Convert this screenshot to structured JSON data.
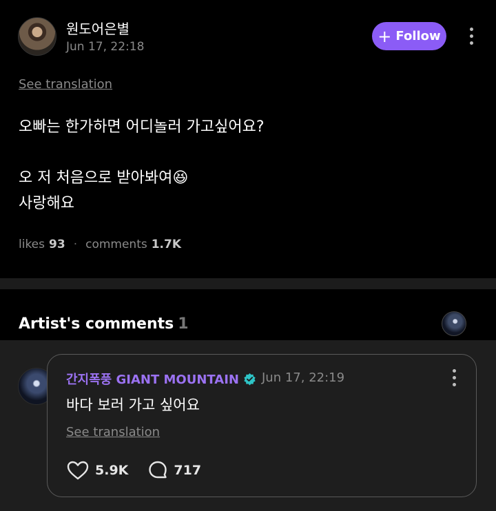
{
  "post": {
    "author_name": "원도어은별",
    "timestamp": "Jun 17, 22:18",
    "follow_label": "Follow",
    "follow_icon": "plus-icon",
    "see_translation": "See translation",
    "body": "오빠는 한가하면 어디놀러 가고싶어요?\n\n오 저 처음으로 받아봐여😆\n사랑해요",
    "likes_label": "likes",
    "likes_count": "93",
    "comments_label": "comments",
    "comments_count": "1.7K"
  },
  "artist_comments": {
    "title": "Artist's comments",
    "count": "1"
  },
  "comment": {
    "author": "간지폭풍 GIANT MOUNTAIN",
    "verified_icon": "verified-badge-icon",
    "timestamp": "Jun 17, 22:19",
    "text": "바다 보러 가고 싶어요",
    "see_translation": "See translation",
    "likes": "5.9K",
    "replies": "717"
  },
  "colors": {
    "accent": "#8b5cf6",
    "author_purple": "#9b72f2",
    "verified_teal": "#2ec4c6",
    "background": "#000000",
    "comment_bg": "#1e1e1e"
  }
}
